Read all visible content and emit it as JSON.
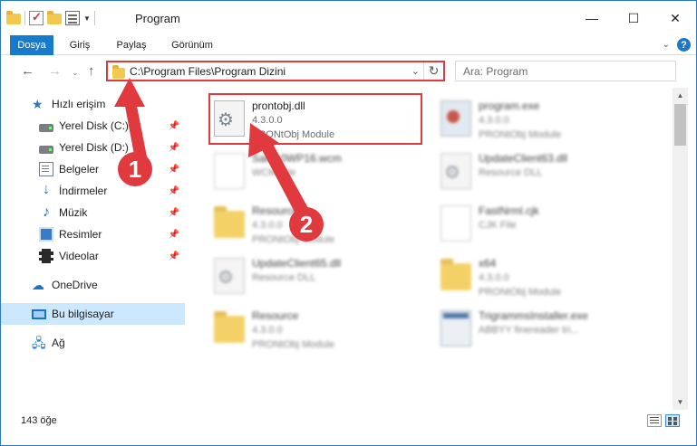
{
  "window": {
    "title": "Program",
    "controls": [
      "—",
      "☐",
      "✕"
    ]
  },
  "ribbon": {
    "tabs": [
      "Dosya",
      "Giriş",
      "Paylaş",
      "Görünüm"
    ]
  },
  "address": {
    "path": "C:\\Program Files\\Program Dizini",
    "search_placeholder": "Ara: Program"
  },
  "nav": {
    "quick_access": "Hızlı erişim",
    "items": [
      {
        "label": "Yerel Disk (C:)",
        "icon": "disk-icon",
        "pinned": true
      },
      {
        "label": "Yerel Disk (D:)",
        "icon": "disk-icon",
        "pinned": true
      },
      {
        "label": "Belgeler",
        "icon": "document-icon",
        "pinned": true
      },
      {
        "label": "İndirmeler",
        "icon": "download-icon",
        "pinned": true
      },
      {
        "label": "Müzik",
        "icon": "music-icon",
        "pinned": true
      },
      {
        "label": "Resimler",
        "icon": "picture-icon",
        "pinned": true
      },
      {
        "label": "Videolar",
        "icon": "video-icon",
        "pinned": true
      }
    ],
    "onedrive": "OneDrive",
    "this_pc": "Bu bilgisayar",
    "network": "Ağ"
  },
  "files": [
    {
      "name": "prontobj.dll",
      "meta1": "4.3.0.0",
      "meta2": "PRONtObj Module",
      "icon": "dll-icon",
      "highlighted": true
    },
    {
      "name": "program.exe",
      "meta1": "4.3.0.0",
      "meta2": "PRONtObj Module",
      "icon": "exe-icon"
    },
    {
      "name": "Samp0WP16.wcm",
      "meta1": "WCM File",
      "meta2": "",
      "icon": "blank-file-icon"
    },
    {
      "name": "UpdateClient63.dll",
      "meta1": "Resource DLL",
      "meta2": "",
      "icon": "dll-icon"
    },
    {
      "name": "Resource",
      "meta1": "4.3.0.0",
      "meta2": "PRONtObj Module",
      "icon": "folder-icon"
    },
    {
      "name": "FastNrml.cjk",
      "meta1": "CJK File",
      "meta2": "",
      "icon": "blank-file-icon"
    },
    {
      "name": "UpdateClient65.dll",
      "meta1": "Resource DLL",
      "meta2": "",
      "icon": "dll-icon"
    },
    {
      "name": "x64",
      "meta1": "4.3.0.0",
      "meta2": "PRONtObj Module",
      "icon": "folder-icon"
    },
    {
      "name": "Resource",
      "meta1": "4.3.0.0",
      "meta2": "PRONtObj Module",
      "icon": "folder-icon"
    },
    {
      "name": "TrigrammsInstaller.exe",
      "meta1": "ABBYY finereader tri...",
      "meta2": "",
      "icon": "installer-icon"
    }
  ],
  "status": {
    "item_count": "143 öğe"
  },
  "annotations": {
    "step1": "1",
    "step2": "2",
    "color": "#e03a3e"
  }
}
